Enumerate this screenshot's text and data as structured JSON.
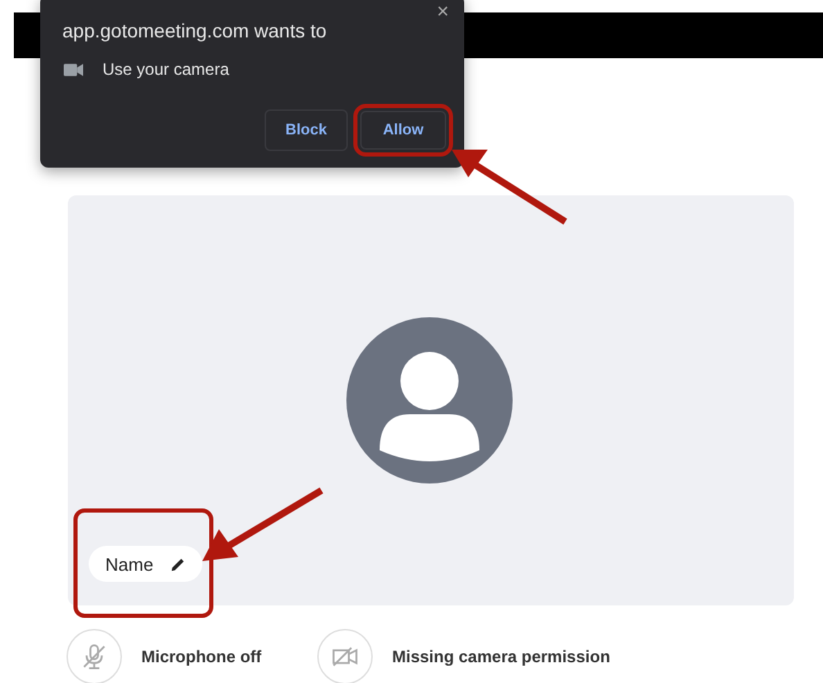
{
  "permission_popup": {
    "title": "app.gotomeeting.com wants to",
    "close": "×",
    "request": "Use your camera",
    "buttons": [
      {
        "label": "Block",
        "highlighted": false
      },
      {
        "label": "Allow",
        "highlighted": true
      }
    ]
  },
  "preview": {
    "name": "Name",
    "name_highlighted": true
  },
  "status_items": [
    {
      "kind": "microphone",
      "label": "Microphone off"
    },
    {
      "kind": "camera",
      "label": "Missing camera permission"
    }
  ]
}
